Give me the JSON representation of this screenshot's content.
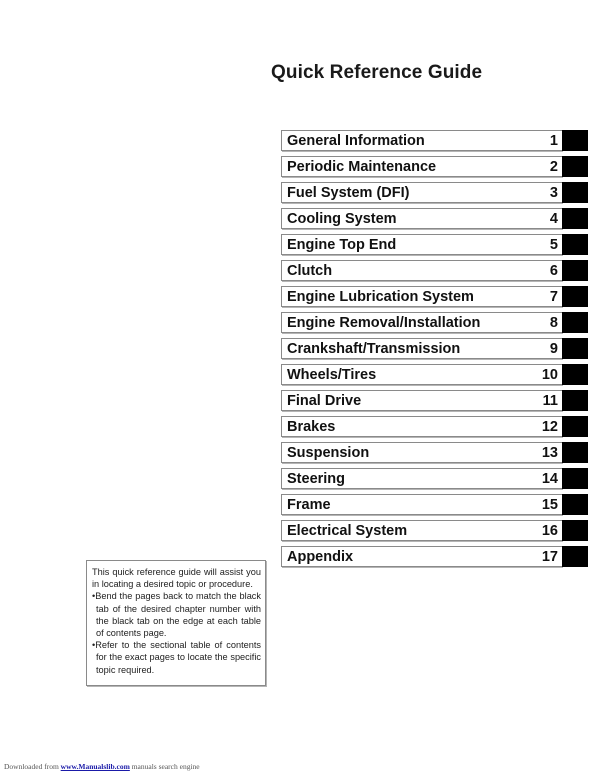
{
  "page": {
    "title": "Quick Reference Guide"
  },
  "toc": {
    "items": [
      {
        "label": "General Information",
        "number": "1"
      },
      {
        "label": "Periodic Maintenance",
        "number": "2"
      },
      {
        "label": "Fuel System (DFI)",
        "number": "3"
      },
      {
        "label": "Cooling System",
        "number": "4"
      },
      {
        "label": "Engine Top End",
        "number": "5"
      },
      {
        "label": "Clutch",
        "number": "6"
      },
      {
        "label": "Engine Lubrication System",
        "number": "7"
      },
      {
        "label": "Engine Removal/Installation",
        "number": "8"
      },
      {
        "label": "Crankshaft/Transmission",
        "number": "9"
      },
      {
        "label": "Wheels/Tires",
        "number": "10"
      },
      {
        "label": "Final Drive",
        "number": "11"
      },
      {
        "label": "Brakes",
        "number": "12"
      },
      {
        "label": "Suspension",
        "number": "13"
      },
      {
        "label": "Steering",
        "number": "14"
      },
      {
        "label": "Frame",
        "number": "15"
      },
      {
        "label": "Electrical System",
        "number": "16"
      },
      {
        "label": "Appendix",
        "number": "17"
      }
    ],
    "tab_color": "#000000"
  },
  "info_box": {
    "intro": "This quick reference guide will assist you in locating a desired topic or procedure.",
    "bullets": [
      "•Bend the pages back to match the black tab of the desired chapter number with the black tab on the edge at each table of contents page.",
      "•Refer to the sectional table of contents for the exact pages to locate the specific topic required."
    ]
  },
  "footer": {
    "prefix": "Downloaded from",
    "link_text": "www.Manualslib.com",
    "suffix": "manuals search engine"
  }
}
